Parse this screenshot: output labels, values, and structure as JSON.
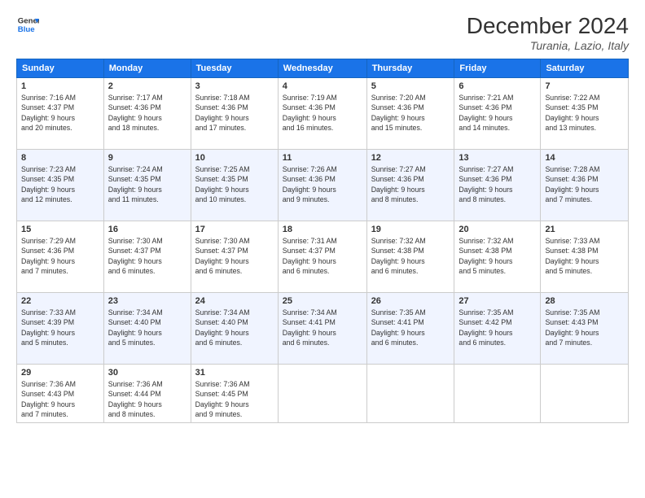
{
  "header": {
    "logo_line1": "General",
    "logo_line2": "Blue",
    "month_year": "December 2024",
    "location": "Turania, Lazio, Italy"
  },
  "days_of_week": [
    "Sunday",
    "Monday",
    "Tuesday",
    "Wednesday",
    "Thursday",
    "Friday",
    "Saturday"
  ],
  "weeks": [
    [
      {
        "day": "1",
        "sunrise": "7:16 AM",
        "sunset": "4:37 PM",
        "daylight_hours": "9",
        "daylight_minutes": "20"
      },
      {
        "day": "2",
        "sunrise": "7:17 AM",
        "sunset": "4:36 PM",
        "daylight_hours": "9",
        "daylight_minutes": "18"
      },
      {
        "day": "3",
        "sunrise": "7:18 AM",
        "sunset": "4:36 PM",
        "daylight_hours": "9",
        "daylight_minutes": "17"
      },
      {
        "day": "4",
        "sunrise": "7:19 AM",
        "sunset": "4:36 PM",
        "daylight_hours": "9",
        "daylight_minutes": "16"
      },
      {
        "day": "5",
        "sunrise": "7:20 AM",
        "sunset": "4:36 PM",
        "daylight_hours": "9",
        "daylight_minutes": "15"
      },
      {
        "day": "6",
        "sunrise": "7:21 AM",
        "sunset": "4:36 PM",
        "daylight_hours": "9",
        "daylight_minutes": "14"
      },
      {
        "day": "7",
        "sunrise": "7:22 AM",
        "sunset": "4:35 PM",
        "daylight_hours": "9",
        "daylight_minutes": "13"
      }
    ],
    [
      {
        "day": "8",
        "sunrise": "7:23 AM",
        "sunset": "4:35 PM",
        "daylight_hours": "9",
        "daylight_minutes": "12"
      },
      {
        "day": "9",
        "sunrise": "7:24 AM",
        "sunset": "4:35 PM",
        "daylight_hours": "9",
        "daylight_minutes": "11"
      },
      {
        "day": "10",
        "sunrise": "7:25 AM",
        "sunset": "4:35 PM",
        "daylight_hours": "9",
        "daylight_minutes": "10"
      },
      {
        "day": "11",
        "sunrise": "7:26 AM",
        "sunset": "4:36 PM",
        "daylight_hours": "9",
        "daylight_minutes": "9"
      },
      {
        "day": "12",
        "sunrise": "7:27 AM",
        "sunset": "4:36 PM",
        "daylight_hours": "9",
        "daylight_minutes": "8"
      },
      {
        "day": "13",
        "sunrise": "7:27 AM",
        "sunset": "4:36 PM",
        "daylight_hours": "9",
        "daylight_minutes": "8"
      },
      {
        "day": "14",
        "sunrise": "7:28 AM",
        "sunset": "4:36 PM",
        "daylight_hours": "9",
        "daylight_minutes": "7"
      }
    ],
    [
      {
        "day": "15",
        "sunrise": "7:29 AM",
        "sunset": "4:36 PM",
        "daylight_hours": "9",
        "daylight_minutes": "7"
      },
      {
        "day": "16",
        "sunrise": "7:30 AM",
        "sunset": "4:37 PM",
        "daylight_hours": "9",
        "daylight_minutes": "6"
      },
      {
        "day": "17",
        "sunrise": "7:30 AM",
        "sunset": "4:37 PM",
        "daylight_hours": "9",
        "daylight_minutes": "6"
      },
      {
        "day": "18",
        "sunrise": "7:31 AM",
        "sunset": "4:37 PM",
        "daylight_hours": "9",
        "daylight_minutes": "6"
      },
      {
        "day": "19",
        "sunrise": "7:32 AM",
        "sunset": "4:38 PM",
        "daylight_hours": "9",
        "daylight_minutes": "6"
      },
      {
        "day": "20",
        "sunrise": "7:32 AM",
        "sunset": "4:38 PM",
        "daylight_hours": "9",
        "daylight_minutes": "5"
      },
      {
        "day": "21",
        "sunrise": "7:33 AM",
        "sunset": "4:38 PM",
        "daylight_hours": "9",
        "daylight_minutes": "5"
      }
    ],
    [
      {
        "day": "22",
        "sunrise": "7:33 AM",
        "sunset": "4:39 PM",
        "daylight_hours": "9",
        "daylight_minutes": "5"
      },
      {
        "day": "23",
        "sunrise": "7:34 AM",
        "sunset": "4:40 PM",
        "daylight_hours": "9",
        "daylight_minutes": "5"
      },
      {
        "day": "24",
        "sunrise": "7:34 AM",
        "sunset": "4:40 PM",
        "daylight_hours": "9",
        "daylight_minutes": "6"
      },
      {
        "day": "25",
        "sunrise": "7:34 AM",
        "sunset": "4:41 PM",
        "daylight_hours": "9",
        "daylight_minutes": "6"
      },
      {
        "day": "26",
        "sunrise": "7:35 AM",
        "sunset": "4:41 PM",
        "daylight_hours": "9",
        "daylight_minutes": "6"
      },
      {
        "day": "27",
        "sunrise": "7:35 AM",
        "sunset": "4:42 PM",
        "daylight_hours": "9",
        "daylight_minutes": "6"
      },
      {
        "day": "28",
        "sunrise": "7:35 AM",
        "sunset": "4:43 PM",
        "daylight_hours": "9",
        "daylight_minutes": "7"
      }
    ],
    [
      {
        "day": "29",
        "sunrise": "7:36 AM",
        "sunset": "4:43 PM",
        "daylight_hours": "9",
        "daylight_minutes": "7"
      },
      {
        "day": "30",
        "sunrise": "7:36 AM",
        "sunset": "4:44 PM",
        "daylight_hours": "9",
        "daylight_minutes": "8"
      },
      {
        "day": "31",
        "sunrise": "7:36 AM",
        "sunset": "4:45 PM",
        "daylight_hours": "9",
        "daylight_minutes": "9"
      },
      null,
      null,
      null,
      null
    ]
  ]
}
